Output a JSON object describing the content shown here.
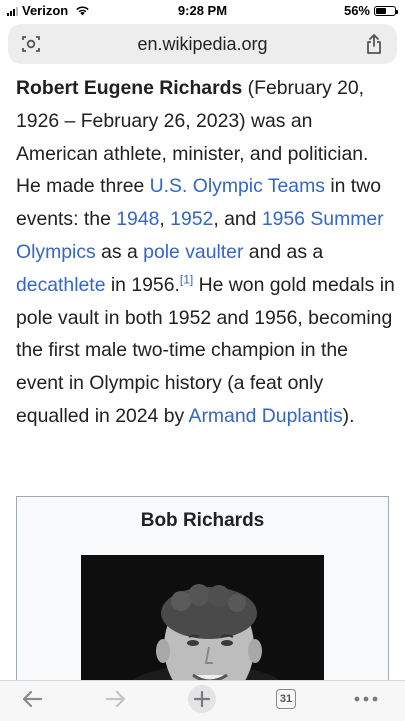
{
  "status_bar": {
    "carrier": "Verizon",
    "time": "9:28 PM",
    "battery_percent": "56%",
    "battery_level": 0.56
  },
  "browser": {
    "url": "en.wikipedia.org",
    "tab_count": "31"
  },
  "article": {
    "subject": "Robert Eugene Richards",
    "t1": " (February 20, 1926 – February 26, 2023) was an American athlete, minister, and politician. He made three ",
    "link_us_olympic_teams": "U.S. Olympic Teams",
    "t2": " in two events: the ",
    "link_1948": "1948",
    "t3": ", ",
    "link_1952": "1952",
    "t4": ", and ",
    "link_1956": "1956 Summer Olympics",
    "t5": " as a ",
    "link_pole_vaulter": "pole vaulter",
    "t6": " and as a ",
    "link_decathlete": "decathlete",
    "t7": " in 1956.",
    "ref": "[1]",
    "t8": " He won gold medals in pole vault in both 1952 and 1956, becoming the first male two-time champion in the event in Olympic history (a feat only equalled in 2024 by ",
    "link_duplantis": "Armand Duplantis",
    "t9": ")."
  },
  "infobox": {
    "title": "Bob Richards"
  },
  "icons": {
    "reader": "reader-mode-icon",
    "share": "share-icon",
    "back": "back-arrow-icon",
    "forward": "forward-arrow-icon",
    "new_tab": "plus-icon",
    "tabs": "tabs-icon",
    "more": "more-icon"
  }
}
